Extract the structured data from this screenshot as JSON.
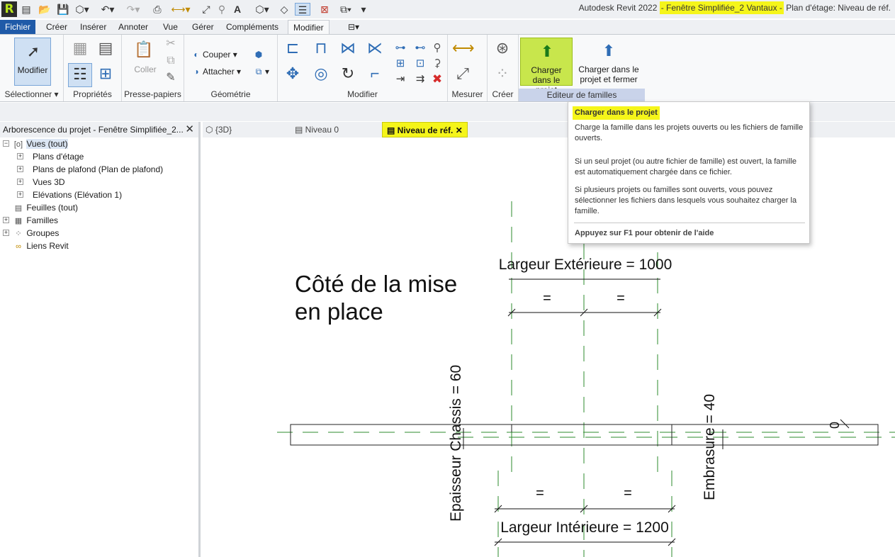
{
  "title": {
    "prefix": "Autodesk Revit 2022",
    "highlight": "- Fenêtre Simplifiée_2 Vantaux -",
    "suffix": "Plan d'étage: Niveau de réf."
  },
  "app_logo": "R",
  "ribbon_tabs": [
    "Fichier",
    "Créer",
    "Insérer",
    "Annoter",
    "Vue",
    "Gérer",
    "Compléments",
    "Modifier"
  ],
  "ribbon": {
    "modifier_button": "Modifier",
    "coller": "Coller",
    "couper": "Couper",
    "attacher": "Attacher",
    "charger_projet": "Charger dans le projet",
    "charger_fermer": "Charger dans le projet et fermer",
    "panels": {
      "selectionner": "Sélectionner",
      "proprietes": "Propriétés",
      "presse_papiers": "Presse-papiers",
      "geometrie": "Géométrie",
      "modifier": "Modifier",
      "mesurer": "Mesurer",
      "creer": "Créer",
      "editeur": "Editeur de familles"
    }
  },
  "browser": {
    "header": "Arborescence du projet - Fenêtre Simplifiée_2...",
    "items": [
      "Vues (tout)",
      "Plans d'étage",
      "Plans de plafond (Plan de plafond)",
      "Vues 3D",
      "Elévations (Elévation 1)",
      "Feuilles (tout)",
      "Familles",
      "Groupes",
      "Liens Revit"
    ]
  },
  "view_tabs": [
    "{3D}",
    "Niveau 0",
    "Niveau de réf."
  ],
  "drawing": {
    "placement_line1": "Côté de la mise",
    "placement_line2": "en place",
    "largeur_exterieure": "Largeur Extérieure = 1000",
    "largeur_interieure": "Largeur Intérieure = 1200",
    "epaisseur_chassis": "Epaisseur Chassis = 60",
    "embrasure": "Embrasure = 40",
    "equal": "=",
    "zero": "0"
  },
  "tooltip": {
    "title": "Charger dans le projet",
    "p1": "Charge la famille dans les projets ouverts ou les fichiers de famille ouverts.",
    "p2": "Si un seul projet (ou autre fichier de famille) est ouvert, la famille est automatiquement chargée dans ce fichier.",
    "p3": "Si plusieurs projets ou familles sont ouverts, vous pouvez sélectionner les fichiers dans lesquels vous souhaitez charger la famille.",
    "help": "Appuyez sur F1 pour obtenir de l'aide"
  },
  "colors": {
    "highlight": "#f5f51a",
    "ref_line": "#2e8b2e",
    "file_tab": "#1f5aa8",
    "charger_button": "#c8e64c"
  }
}
